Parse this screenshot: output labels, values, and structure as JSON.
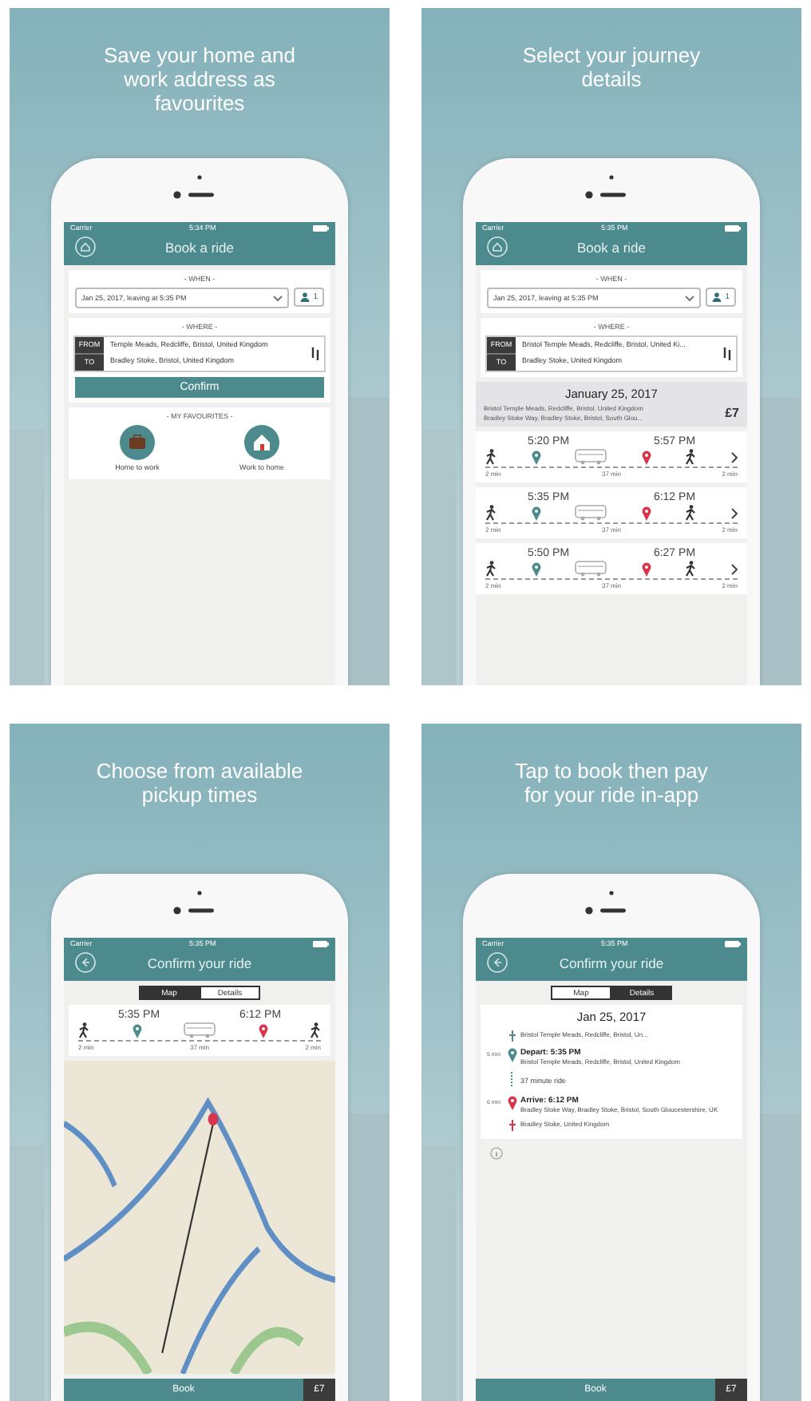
{
  "panels": [
    {
      "kind": "booking",
      "caption": "Save your home and work address as favourites",
      "status_bar": {
        "carrier": "Carrier",
        "time": "5:34 PM"
      },
      "screen_title": "Book a ride",
      "when_label": "- WHEN -",
      "when_value": "Jan 25, 2017, leaving at 5:35 PM",
      "passengers": "1",
      "where_label": "- WHERE -",
      "from_label": "FROM",
      "from_value": "Temple Meads, Redcliffe, Bristol, United Kingdom",
      "to_label": "TO",
      "to_value": "Bradley Stoke, Bristol, United Kingdom",
      "confirm": "Confirm",
      "favourites_label": "- MY FAVOURITES -",
      "favourites": [
        {
          "kind": "work",
          "label": "Home to work"
        },
        {
          "kind": "home",
          "label": "Work to home"
        }
      ]
    },
    {
      "kind": "results",
      "caption": "Select your journey details",
      "status_bar": {
        "carrier": "Carrier",
        "time": "5:35 PM"
      },
      "screen_title": "Book a ride",
      "when_label": "- WHEN -",
      "when_value": "Jan 25, 2017, leaving at 5:35 PM",
      "passengers": "1",
      "where_label": "- WHERE -",
      "from_label": "FROM",
      "from_value": "Bristol Temple Meads, Redcliffe, Bristol, United Ki...",
      "to_label": "TO",
      "to_value": "Bradley Stoke, United Kingdom",
      "summary": {
        "date": "January 25, 2017",
        "from": "Bristol Temple Meads, Redcliffe, Bristol, United Kingdom",
        "to": "Bradley Stoke Way, Bradley Stoke, Bristol, South Glou...",
        "price": "£7"
      },
      "journeys": [
        {
          "depart": "5:20 PM",
          "arrive": "5:57 PM",
          "walk_start": "2 min",
          "duration": "37 min",
          "walk_end": "2 min"
        },
        {
          "depart": "5:35 PM",
          "arrive": "6:12 PM",
          "walk_start": "2 min",
          "duration": "37 min",
          "walk_end": "2 min"
        },
        {
          "depart": "5:50 PM",
          "arrive": "6:27 PM",
          "walk_start": "2 min",
          "duration": "37 min",
          "walk_end": "2 min"
        }
      ]
    },
    {
      "kind": "map",
      "caption": "Choose from available pickup times",
      "status_bar": {
        "carrier": "Carrier",
        "time": "5:35 PM"
      },
      "screen_title": "Confirm your ride",
      "tabs": [
        {
          "label": "Map",
          "selected": true
        },
        {
          "label": "Details",
          "selected": false
        }
      ],
      "journey": {
        "depart": "5:35 PM",
        "arrive": "6:12 PM",
        "walk_start": "2 min",
        "duration": "37 min",
        "walk_end": "2 min"
      },
      "book": "Book",
      "price": "£7"
    },
    {
      "kind": "details",
      "caption": "Tap to book then pay for your ride in-app",
      "status_bar": {
        "carrier": "Carrier",
        "time": "5:35 PM"
      },
      "screen_title": "Confirm your ride",
      "tabs": [
        {
          "label": "Map",
          "selected": false
        },
        {
          "label": "Details",
          "selected": true
        }
      ],
      "date": "Jan 25, 2017",
      "stops": [
        {
          "kind": "walk_start",
          "text": "Bristol Temple Meads, Redcliffe, Bristol, Un..."
        },
        {
          "kind": "depart",
          "side": "5 min",
          "heading": "Depart: 5:35 PM",
          "text": "Bristol Temple Meads, Redcliffe, Bristol, United Kingdom"
        },
        {
          "kind": "ride",
          "text": "37 minute ride"
        },
        {
          "kind": "arrive",
          "side": "6 min",
          "heading": "Arrive: 6:12 PM",
          "text": "Bradley Stoke Way, Bradley Stoke, Bristol, South Gloucestershire, UK"
        },
        {
          "kind": "walk_end",
          "text": "Bradley Stoke, United Kingdom"
        }
      ],
      "book": "Book",
      "price": "£7"
    }
  ]
}
